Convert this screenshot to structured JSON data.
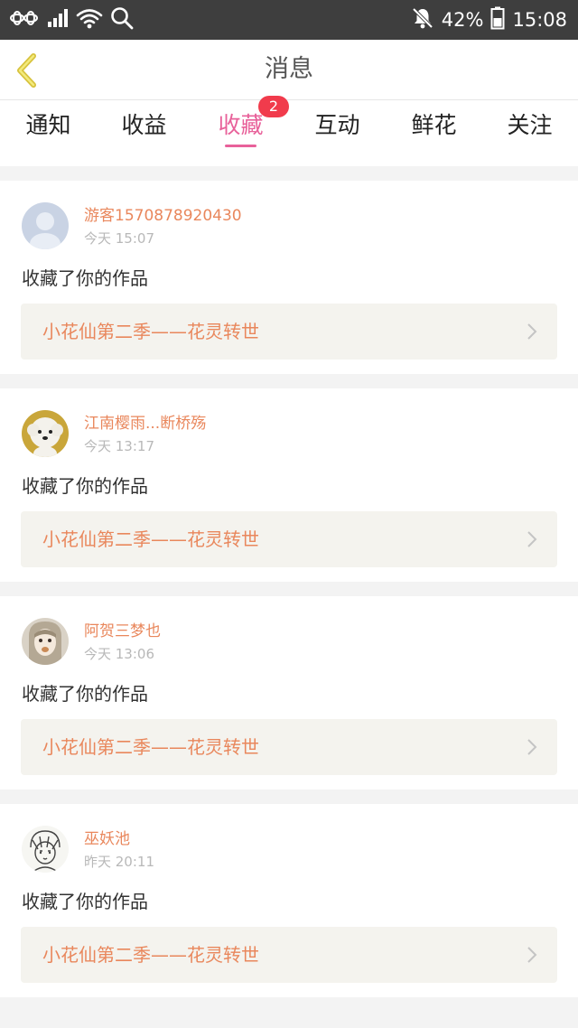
{
  "status_bar": {
    "battery": "42%",
    "time": "15:08",
    "icons": [
      "unicom-icon",
      "signal-icon",
      "wifi-icon",
      "search-icon",
      "bell-off-icon",
      "battery-icon"
    ]
  },
  "header": {
    "title": "消息",
    "back_icon": "chevron-left-icon"
  },
  "tabs": [
    {
      "label": "通知",
      "active": false
    },
    {
      "label": "收益",
      "active": false
    },
    {
      "label": "收藏",
      "active": true,
      "badge": "2"
    },
    {
      "label": "互动",
      "active": false
    },
    {
      "label": "鲜花",
      "active": false
    },
    {
      "label": "关注",
      "active": false
    }
  ],
  "colors": {
    "accent": "#e8619a",
    "badge": "#f13b4c",
    "name": "#e9875c",
    "status_bar": "#3e3e3e"
  },
  "messages": [
    {
      "user": "游客1570878920430",
      "time": "今天 15:07",
      "action": "收藏了你的作品",
      "work": "小花仙第二季——花灵转世",
      "avatar": "default-avatar"
    },
    {
      "user": "江南樱雨...断桥殇",
      "time": "今天 13:17",
      "action": "收藏了你的作品",
      "work": "小花仙第二季——花灵转世",
      "avatar": "dog-avatar"
    },
    {
      "user": "阿贺三梦也",
      "time": "今天 13:06",
      "action": "收藏了你的作品",
      "work": "小花仙第二季——花灵转世",
      "avatar": "doll-avatar"
    },
    {
      "user": "巫妖池",
      "time": "昨天 20:11",
      "action": "收藏了你的作品",
      "work": "小花仙第二季——花灵转世",
      "avatar": "sketch-avatar"
    }
  ]
}
